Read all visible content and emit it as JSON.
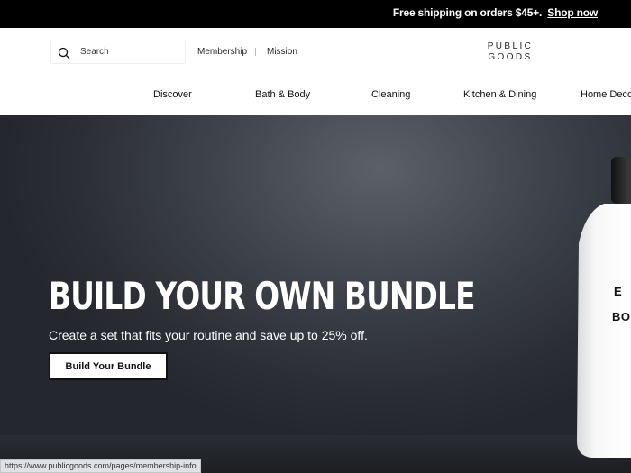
{
  "promo": {
    "text": "Free shipping on orders $45+.",
    "link": "Shop now"
  },
  "header": {
    "search_placeholder": "Search",
    "links": [
      "Membership",
      "Mission"
    ],
    "logo_line1": "PUBLIC",
    "logo_line2": "GOODS"
  },
  "nav": {
    "items": [
      "Discover",
      "Bath & Body",
      "Cleaning",
      "Kitchen & Dining",
      "Home Deco"
    ]
  },
  "hero": {
    "title": "BUILD YOUR OWN BUNDLE",
    "subtitle": "Create a set that fits your routine and save up to 25% off.",
    "button": "Build Your Bundle",
    "bottle_label_1": "E",
    "bottle_label_2": "BOD"
  },
  "status_bar": {
    "url": "https://www.publicgoods.com/pages/membership-info"
  },
  "colors": {
    "promo_bg": "#000000",
    "hero_bg": "#2f3239",
    "text_primary": "#111111"
  },
  "icons": {
    "search": "magnifying-glass"
  }
}
